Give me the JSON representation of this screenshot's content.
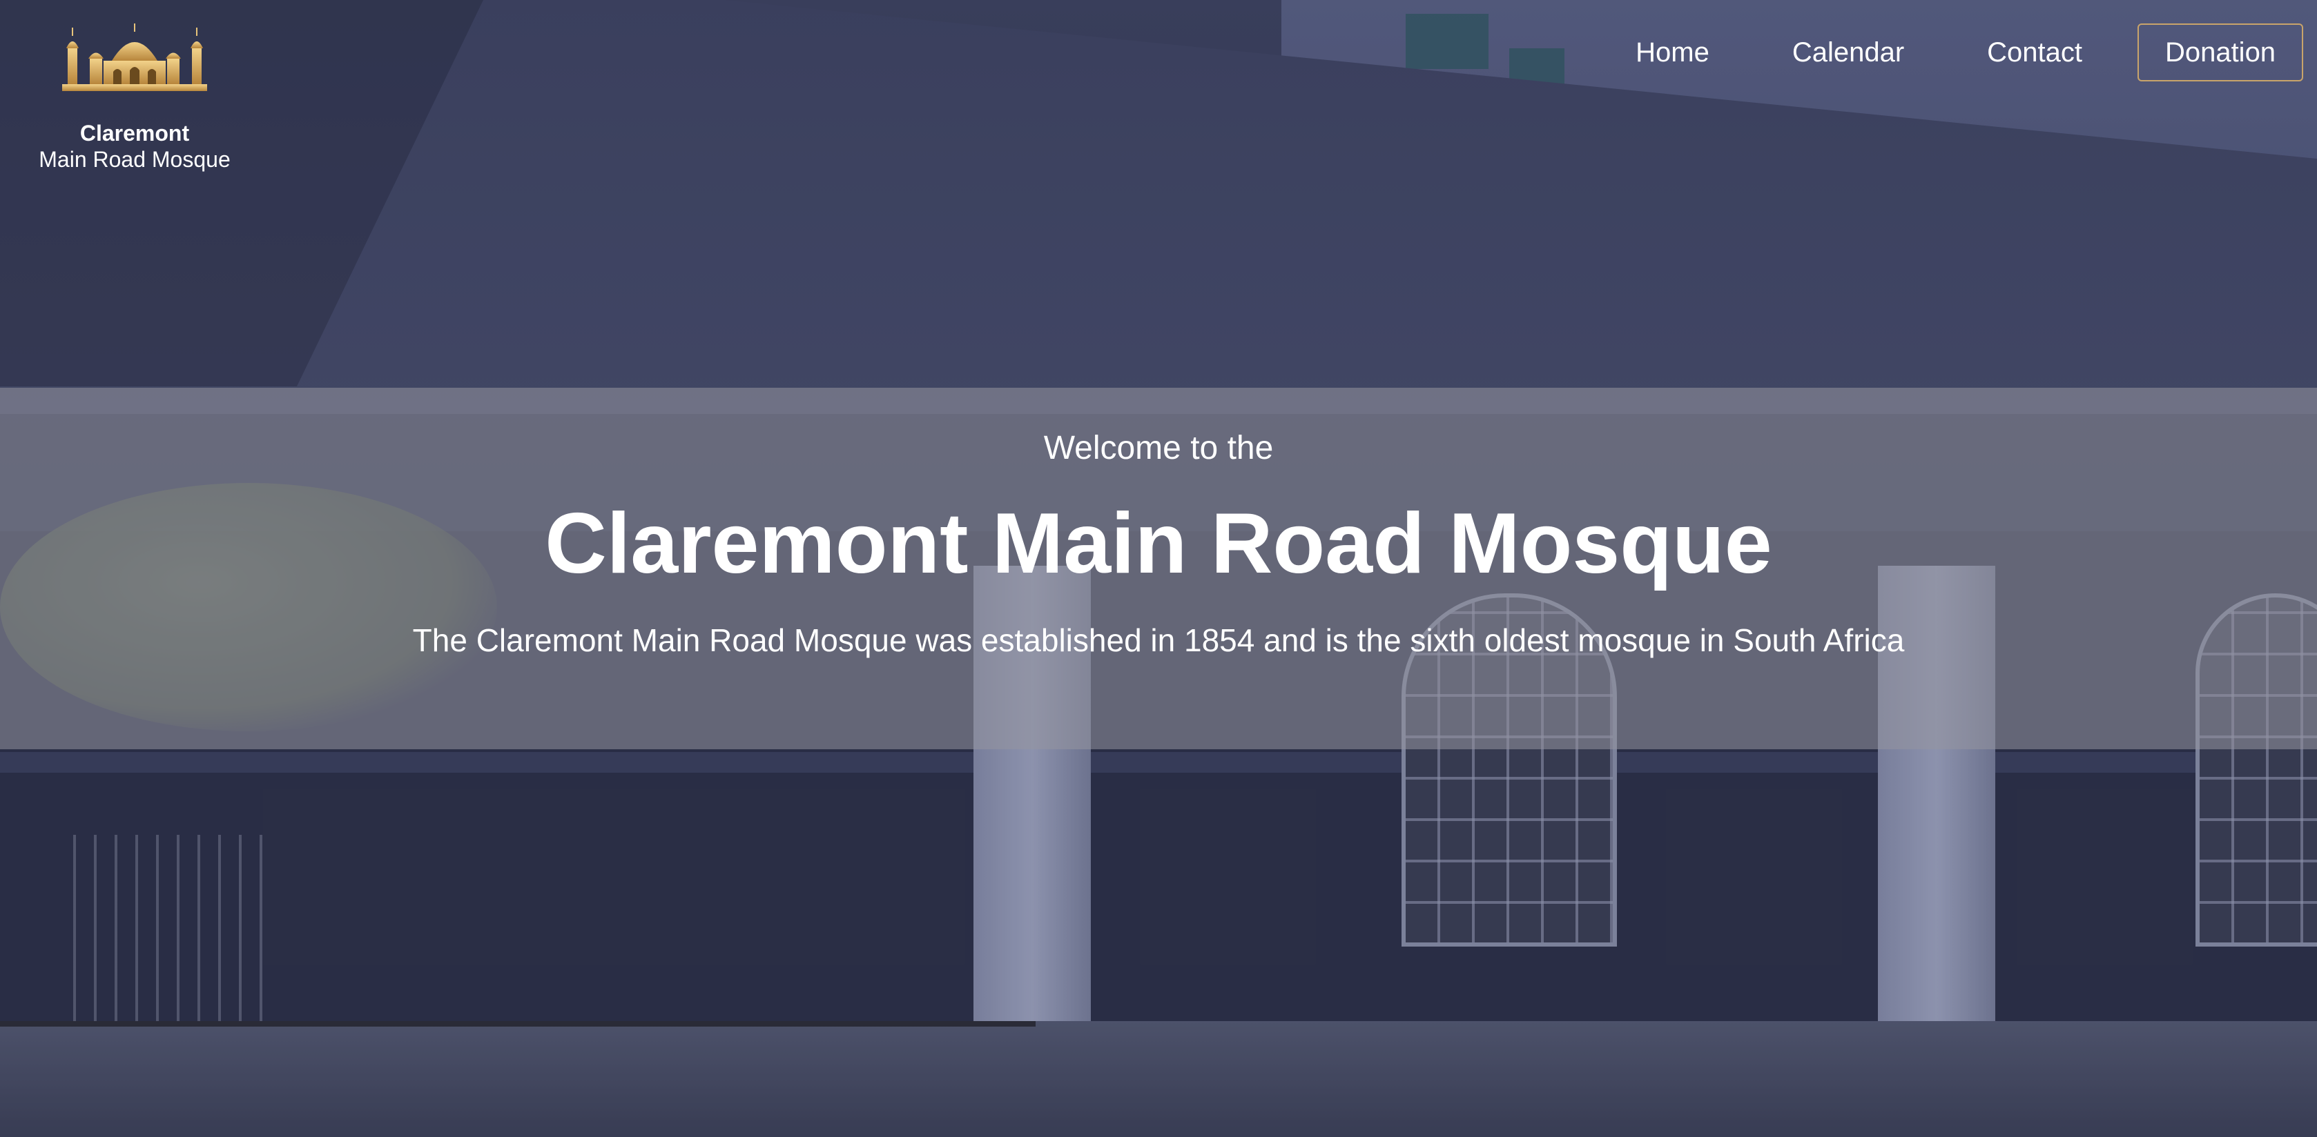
{
  "logo": {
    "icon": "mosque-icon",
    "name": "Claremont",
    "subtitle": "Main Road Mosque"
  },
  "nav": {
    "items": [
      {
        "label": "Home"
      },
      {
        "label": "Calendar"
      },
      {
        "label": "Contact"
      }
    ],
    "donate_label": "Donation"
  },
  "hero": {
    "welcome": "Welcome to the",
    "title": "Claremont Main Road Mosque",
    "description": "The Claremont Main Road Mosque was established in 1854 and is the sixth oldest mosque in South Africa"
  },
  "colors": {
    "accent_border": "#c9a46a",
    "text": "#ffffff",
    "band_overlay": "rgba(150,150,160,.55)"
  }
}
